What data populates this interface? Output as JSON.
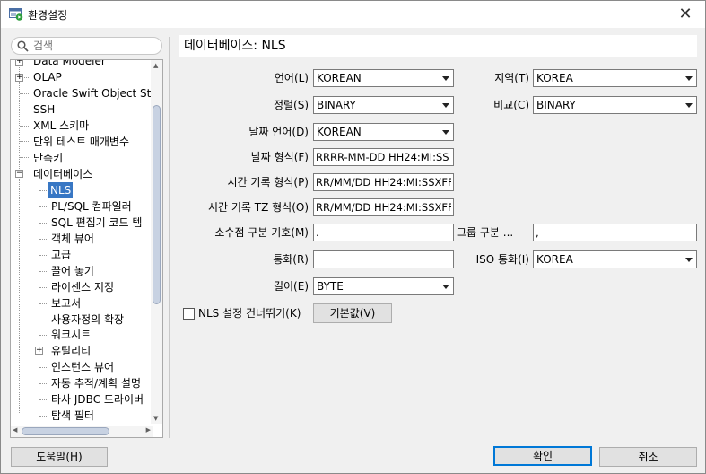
{
  "window": {
    "title": "환경설정",
    "close_glyph": "✕"
  },
  "search": {
    "placeholder": "검색"
  },
  "tree": {
    "items": [
      {
        "label": "Data Modeler"
      },
      {
        "label": "OLAP"
      },
      {
        "label": "Oracle Swift Object Sto"
      },
      {
        "label": "SSH"
      },
      {
        "label": "XML 스키마"
      },
      {
        "label": "단위 테스트 매개변수"
      },
      {
        "label": "단축키"
      },
      {
        "label": "데이터베이스"
      },
      {
        "label": "NLS"
      },
      {
        "label": "PL/SQL 컴파일러"
      },
      {
        "label": "SQL 편집기 코드 템"
      },
      {
        "label": "객체 뷰어"
      },
      {
        "label": "고급"
      },
      {
        "label": "끌어 놓기"
      },
      {
        "label": "라이센스 지정"
      },
      {
        "label": "보고서"
      },
      {
        "label": "사용자정의 확장"
      },
      {
        "label": "워크시트"
      },
      {
        "label": "유틸리티"
      },
      {
        "label": "인스턴스 뷰어"
      },
      {
        "label": "자동 추적/계획 설명"
      },
      {
        "label": "타사 JDBC 드라이버"
      },
      {
        "label": "탐색 필터"
      }
    ],
    "expander_plus": "+",
    "expander_minus": "−"
  },
  "page": {
    "title": "데이터베이스: NLS",
    "language": {
      "label": "언어(L)",
      "value": "KOREAN"
    },
    "territory": {
      "label": "지역(T)",
      "value": "KOREA"
    },
    "sort": {
      "label": "정렬(S)",
      "value": "BINARY"
    },
    "comparison": {
      "label": "비교(C)",
      "value": "BINARY"
    },
    "date_language": {
      "label": "날짜 언어(D)",
      "value": "KOREAN"
    },
    "date_format": {
      "label": "날짜 형식(F)",
      "value": "RRRR-MM-DD HH24:MI:SS"
    },
    "timestamp_format": {
      "label": "시간 기록 형식(P)",
      "value": "RR/MM/DD HH24:MI:SSXFF"
    },
    "timestamp_tz_format": {
      "label": "시간 기록 TZ 형식(O)",
      "value": "RR/MM/DD HH24:MI:SSXFF"
    },
    "decimal_separator": {
      "label": "소수점 구분 기호(M)",
      "value": "."
    },
    "group_separator": {
      "label": "그룹 구분 ...",
      "value": ","
    },
    "currency": {
      "label": "통화(R)",
      "value": ""
    },
    "iso_currency": {
      "label": "ISO 통화(I)",
      "value": "KOREA"
    },
    "length": {
      "label": "길이(E)",
      "value": "BYTE"
    },
    "skip_nls": {
      "label": "NLS 설정 건너뛰기(K)",
      "checked": false
    },
    "defaults_button": "기본값(V)"
  },
  "footer": {
    "help_button": "도움말(H)",
    "ok_button": "확인",
    "cancel_button": "취소"
  }
}
